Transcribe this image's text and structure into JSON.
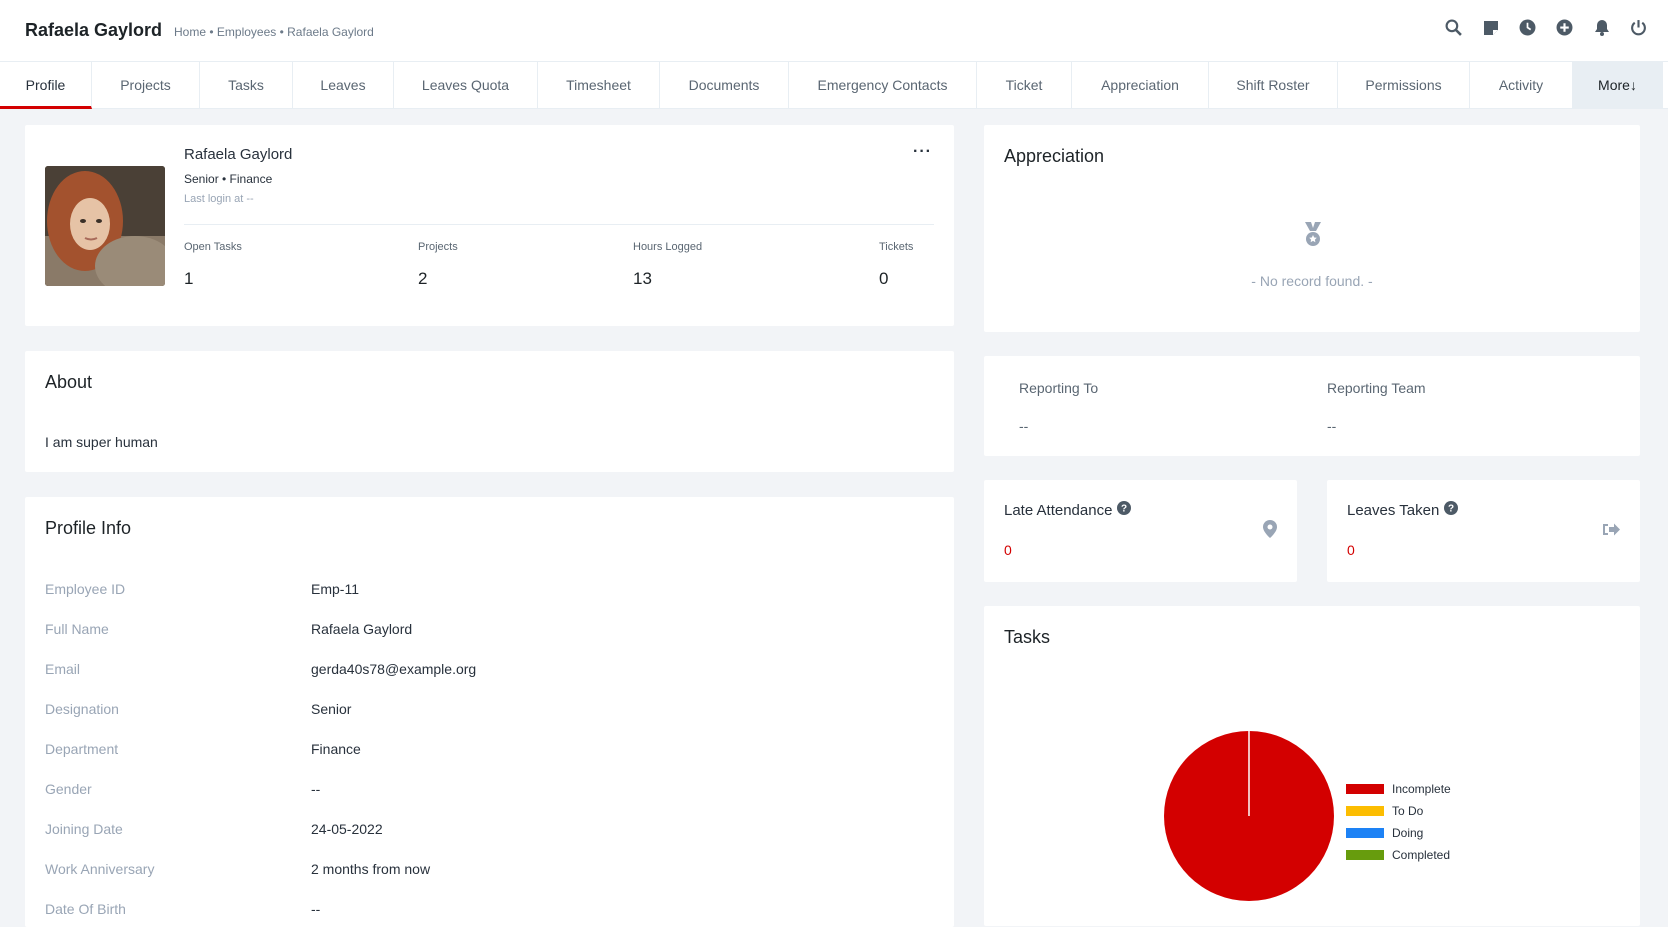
{
  "header": {
    "title": "Rafaela Gaylord",
    "breadcrumb": [
      "Home",
      "Employees",
      "Rafaela Gaylord"
    ],
    "icons": [
      "search-icon",
      "sticky-note-icon",
      "clock-icon",
      "plus-circle-icon",
      "bell-icon",
      "power-icon"
    ]
  },
  "tabs": [
    {
      "label": "Profile",
      "active": true
    },
    {
      "label": "Projects"
    },
    {
      "label": "Tasks"
    },
    {
      "label": "Leaves"
    },
    {
      "label": "Leaves Quota"
    },
    {
      "label": "Timesheet"
    },
    {
      "label": "Documents"
    },
    {
      "label": "Emergency Contacts"
    },
    {
      "label": "Ticket"
    },
    {
      "label": "Appreciation"
    },
    {
      "label": "Shift Roster"
    },
    {
      "label": "Permissions"
    },
    {
      "label": "Activity"
    },
    {
      "label": "More↓"
    }
  ],
  "profile": {
    "name": "Rafaela Gaylord",
    "role": "Senior • Finance",
    "last_login": "Last login at --",
    "stats": [
      {
        "label": "Open Tasks",
        "value": "1"
      },
      {
        "label": "Projects",
        "value": "2"
      },
      {
        "label": "Hours Logged",
        "value": "13"
      },
      {
        "label": "Tickets",
        "value": "0"
      }
    ]
  },
  "about": {
    "title": "About",
    "text": "I am super human"
  },
  "profile_info": {
    "title": "Profile Info",
    "rows": [
      {
        "label": "Employee ID",
        "value": "Emp-11"
      },
      {
        "label": "Full Name",
        "value": "Rafaela Gaylord"
      },
      {
        "label": "Email",
        "value": "gerda40s78@example.org"
      },
      {
        "label": "Designation",
        "value": "Senior"
      },
      {
        "label": "Department",
        "value": "Finance"
      },
      {
        "label": "Gender",
        "value": "--"
      },
      {
        "label": "Joining Date",
        "value": "24-05-2022"
      },
      {
        "label": "Work Anniversary",
        "value": "2 months from now"
      },
      {
        "label": "Date Of Birth",
        "value": "--"
      }
    ]
  },
  "appreciation": {
    "title": "Appreciation",
    "empty": "- No record found. -"
  },
  "reporting": {
    "to_label": "Reporting To",
    "to_value": "--",
    "team_label": "Reporting Team",
    "team_value": "--"
  },
  "late_attendance": {
    "label": "Late Attendance",
    "value": "0"
  },
  "leaves_taken": {
    "label": "Leaves Taken",
    "value": "0"
  },
  "tasks_card": {
    "title": "Tasks"
  },
  "colors": {
    "accent": "#d30000",
    "incomplete": "#d30000",
    "todo": "#fcbd01",
    "doing": "#1d82f5",
    "completed": "#679c0d"
  },
  "chart_data": {
    "type": "pie",
    "categories": [
      "Incomplete",
      "To Do",
      "Doing",
      "Completed"
    ],
    "values": [
      1,
      0,
      0,
      0
    ],
    "colors": [
      "#d30000",
      "#fcbd01",
      "#1d82f5",
      "#679c0d"
    ],
    "legend_position": "right"
  }
}
